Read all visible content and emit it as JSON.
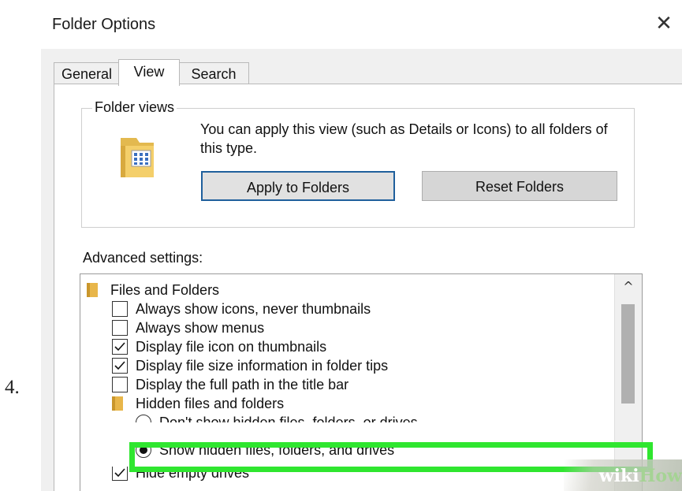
{
  "step_number": "4.",
  "window": {
    "title": "Folder Options",
    "close_glyph": "✕"
  },
  "tabs": [
    {
      "label": "General",
      "active": false
    },
    {
      "label": "View",
      "active": true
    },
    {
      "label": "Search",
      "active": false
    }
  ],
  "folder_views": {
    "group_label": "Folder views",
    "description": "You can apply this view (such as Details or Icons) to all folders of this type.",
    "apply_button": "Apply to Folders",
    "reset_button": "Reset Folders",
    "icon": "folder-grid-icon"
  },
  "advanced": {
    "label": "Advanced settings:",
    "items": [
      {
        "type": "folder",
        "label": "Files and Folders"
      },
      {
        "type": "checkbox",
        "label": "Always show icons, never thumbnails",
        "checked": false
      },
      {
        "type": "checkbox",
        "label": "Always show menus",
        "checked": false
      },
      {
        "type": "checkbox",
        "label": "Display file icon on thumbnails",
        "checked": true
      },
      {
        "type": "checkbox",
        "label": "Display file size information in folder tips",
        "checked": true
      },
      {
        "type": "checkbox",
        "label": "Display the full path in the title bar",
        "checked": false
      },
      {
        "type": "folder",
        "label": "Hidden files and folders"
      },
      {
        "type": "radio",
        "label": "Don't show hidden files, folders, or drives",
        "selected": false
      },
      {
        "type": "radio",
        "label": "Show hidden files, folders, and drives",
        "selected": true
      },
      {
        "type": "checkbox",
        "label": "Hide empty drives",
        "checked": true
      }
    ],
    "scroll_up_glyph": "^"
  },
  "highlight_color": "#2fe62f",
  "watermark": {
    "part1": "wiki",
    "part2": "How"
  }
}
